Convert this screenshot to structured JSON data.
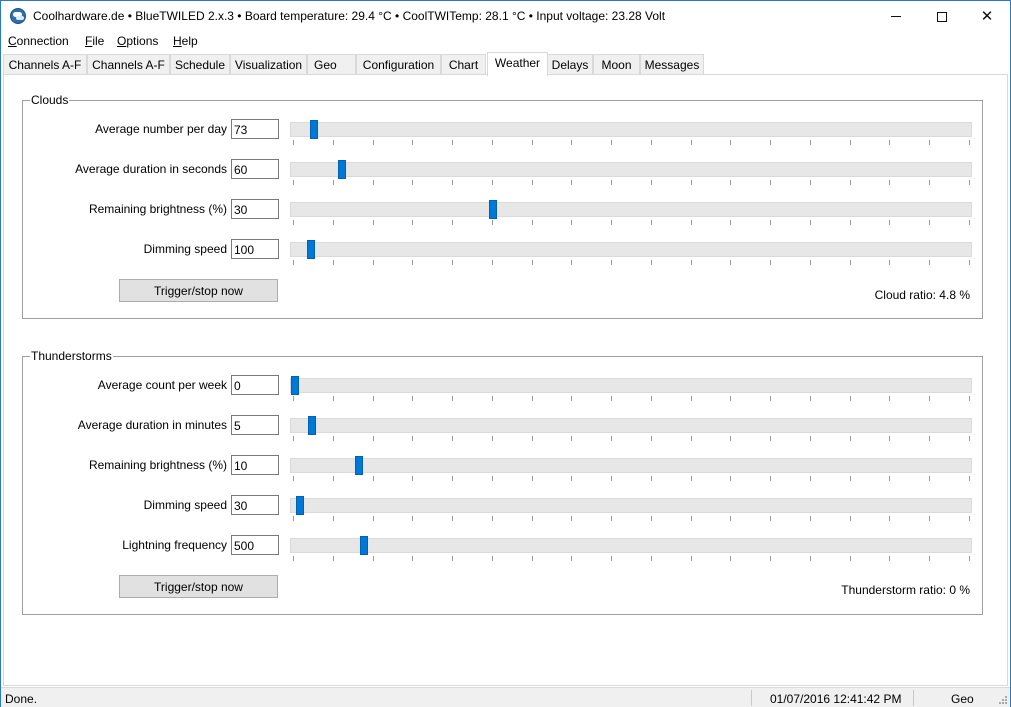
{
  "window": {
    "title": "Coolhardware.de • BlueTWILED 2.x.3 • Board temperature: 29.4 °C • CoolTWITemp: 28.1 °C • Input voltage: 23.28 Volt",
    "minimize_icon": "minimize-icon",
    "maximize_icon": "maximize-icon",
    "close_icon": "close-icon",
    "close_glyph": "✕"
  },
  "menu": {
    "items": [
      {
        "label": "Connection",
        "accel": "C",
        "rest": "onnection"
      },
      {
        "label": "File",
        "accel": "F",
        "rest": "ile"
      },
      {
        "label": "Options",
        "accel": "O",
        "rest": "ptions"
      },
      {
        "label": "Help",
        "accel": "H",
        "rest": "elp"
      }
    ]
  },
  "tabs": [
    {
      "label": "Channels A-F"
    },
    {
      "label": "Channels A-F"
    },
    {
      "label": "Schedule"
    },
    {
      "label": "Visualization"
    },
    {
      "label": "Geo"
    },
    {
      "label": "Configuration"
    },
    {
      "label": "Chart"
    },
    {
      "label": "Weather"
    },
    {
      "label": "Delays"
    },
    {
      "label": "Moon"
    },
    {
      "label": "Messages"
    }
  ],
  "active_tab": "Weather",
  "clouds": {
    "title": "Clouds",
    "rows": [
      {
        "label": "Average number per day",
        "value": "73",
        "level": 0.028
      },
      {
        "label": "Average duration in seconds",
        "value": "60",
        "level": 0.07
      },
      {
        "label": "Remaining brightness (%)",
        "value": "30",
        "level": 0.295
      },
      {
        "label": "Dimming speed",
        "value": "100",
        "level": 0.024
      }
    ],
    "button": "Trigger/stop now",
    "ratio": "Cloud ratio: 4.8 %"
  },
  "thunderstorms": {
    "title": "Thunderstorms",
    "rows": [
      {
        "label": "Average count per week",
        "value": "0",
        "level": 0.0
      },
      {
        "label": "Average duration in minutes",
        "value": "5",
        "level": 0.025
      },
      {
        "label": "Remaining brightness (%)",
        "value": "10",
        "level": 0.095
      },
      {
        "label": "Dimming speed",
        "value": "30",
        "level": 0.008
      },
      {
        "label": "Lightning frequency",
        "value": "500",
        "level": 0.102
      }
    ],
    "button": "Trigger/stop now",
    "ratio": "Thunderstorm ratio: 0 %"
  },
  "statusbar": {
    "status": "Done.",
    "datetime": "01/07/2016 12:41:42 PM",
    "mode": "Geo"
  },
  "colors": {
    "accent": "#0078d7",
    "slider_track": "#e7e7e7",
    "button_face": "#e1e1e1"
  }
}
